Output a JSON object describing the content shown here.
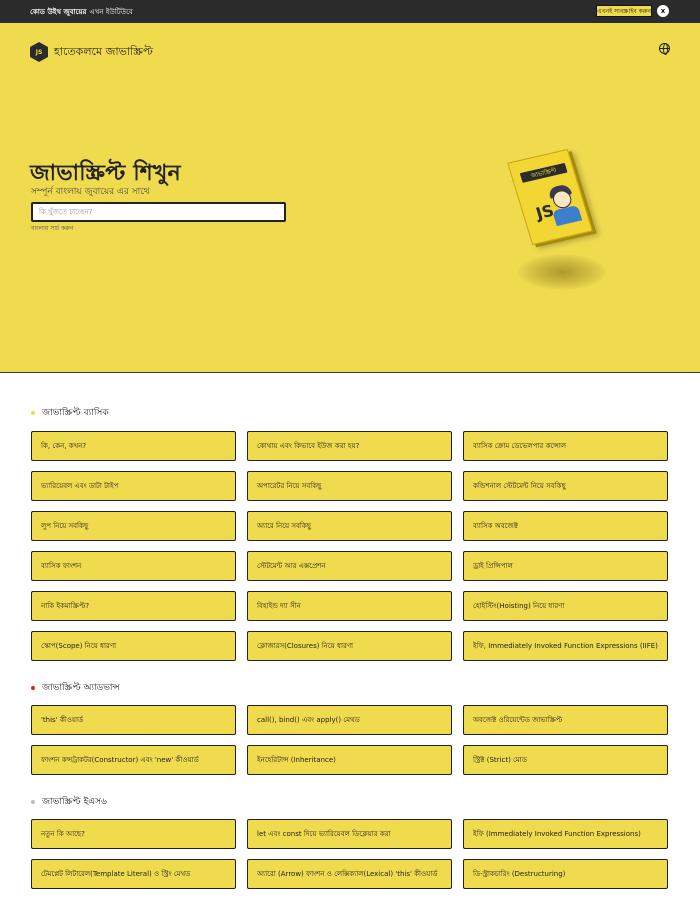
{
  "topbar": {
    "message_bold": "কোড উইথ জুবায়ের",
    "message_rest": "এখন ইউটিউবে",
    "subscribe_label": "এখনই সাবস্ক্রাইব করুন",
    "close_label": "x"
  },
  "header": {
    "logo_badge": "JS",
    "logo_text": "হাতেকলমে জাভাস্ক্রিপ্ট",
    "language_icon": "globe-icon"
  },
  "hero": {
    "title": "জাভাস্ক্রিপ্ট শিখুন",
    "subtitle": "সম্পূর্ন বাংলায় জুবায়ের এর সাথে",
    "search_placeholder": "কি খুঁজতে চাচ্ছেন?",
    "search_hint": "বাংলায় সার্চ করুন",
    "book_title": "জাভাস্ক্রিপ্ট",
    "book_badge": "JS",
    "colors": {
      "brand_yellow": "#f0db4f",
      "dark": "#2b2b2b"
    }
  },
  "sections": [
    {
      "title": "জাভাস্ক্রিপ্ট ব্যাসিক",
      "dot_color": "#f0db4f",
      "items": [
        "কি, কেন, কখন?",
        "কোথায় এবং কিভাবে ইউজ করা হয়?",
        "ব্যাসিক ক্রোম ডেভেলপার কন্সোল",
        "ভ্যারিয়েবল এবং ডাটা টাইপ",
        "অপারেটর নিয়ে সবকিছু",
        "কন্ডিশনাল স্টেটমেন্ট নিয়ে সবকিছু",
        "লুপ নিয়ে সবকিছু",
        "অ্যারে নিয়ে সবকিছু",
        "ব্যাসিক অবজেক্ট",
        "ব্যাসিক ফাংশন",
        "স্টেটমেন্ট আর এক্সপ্রেশন",
        "ড্রাই প্রিন্সিপাল",
        "নাকি ইকমাস্ক্রিপ্ট?",
        "বিহাইন্ড দ্যা সীন",
        "হোইস্টিং(Hoisting) নিয়ে ধারণা",
        "স্কোপ(Scope) নিয়ে ধারণা",
        "ক্লোজারস(Closures) নিয়ে ধারণা",
        "ইফি, Immediately Invoked Function Expressions (IIFE)"
      ]
    },
    {
      "title": "জাভাস্ক্রিপ্ট অ্যাডভান্স",
      "dot_color": "#e0201b",
      "items": [
        "'this' কীওয়ার্ড",
        "call(), bind() এবং apply() মেথড",
        "অবজেক্ট ওরিয়েন্টেড জাভাস্ক্রিপ্ট",
        "ফাংশন কন্সট্রাকটর(Constructor) এবং 'new' কীওয়ার্ড",
        "ইনহেরিটান্স (Inheritance)",
        "স্ট্রিক্ট (Strict) মোড"
      ]
    },
    {
      "title": "জাভাস্ক্রিপ্ট ইএস৬",
      "dot_color": "#bbbbbb",
      "items": [
        "নতুন কি আছে?",
        "let এবং const দিয়ে ভ্যারিয়েবল ডিক্লেয়ার করা",
        "ইফি (Immediately Invoked Function Expressions)",
        "টেমপ্লেট লিটারেল(Template Literal) ও স্ট্রিং মেথড",
        "অ্যারো (Arrow) ফাংশন ও লেক্সিক্যাল(Lexical) 'this' কীওয়ার্ড",
        "ডি-স্ট্রাকচারিং (Destructuring)"
      ]
    }
  ]
}
